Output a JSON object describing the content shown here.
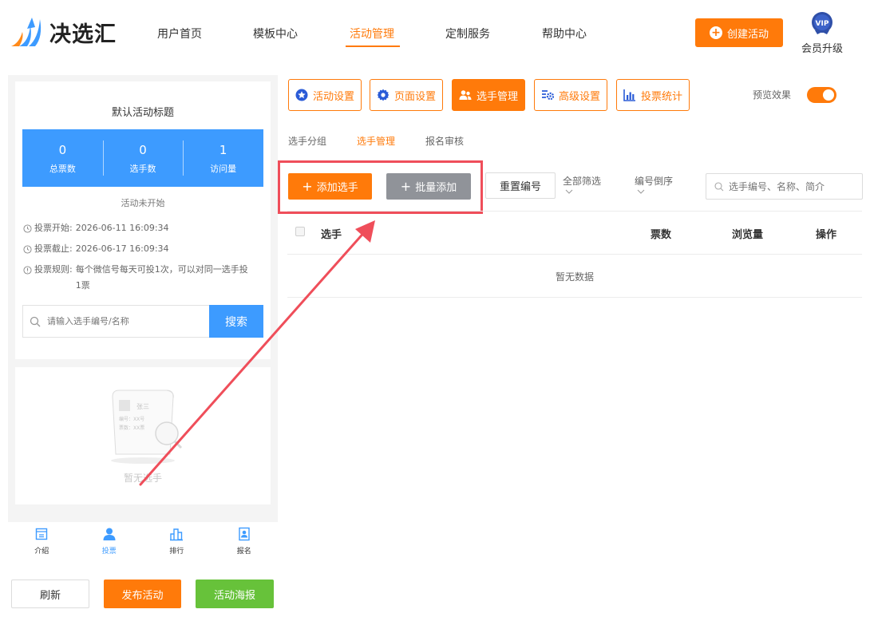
{
  "brand": {
    "name": "决选汇"
  },
  "nav": [
    {
      "label": "用户首页",
      "active": false
    },
    {
      "label": "模板中心",
      "active": false
    },
    {
      "label": "活动管理",
      "active": true
    },
    {
      "label": "定制服务",
      "active": false
    },
    {
      "label": "帮助中心",
      "active": false
    }
  ],
  "header": {
    "create_label": "创建活动",
    "vip_badge": "VIP",
    "vip_label": "会员升级"
  },
  "preview": {
    "title": "默认活动标题",
    "stats": [
      {
        "value": "0",
        "label": "总票数"
      },
      {
        "value": "0",
        "label": "选手数"
      },
      {
        "value": "1",
        "label": "访问量"
      }
    ],
    "status": "活动未开始",
    "info": [
      {
        "label": "投票开始:",
        "value": "2026-06-11 16:09:34"
      },
      {
        "label": "投票截止:",
        "value": "2026-06-17 16:09:34"
      },
      {
        "label": "投票规则:",
        "value": "每个微信号每天可投1次，可以对同一选手投1票"
      }
    ],
    "search_placeholder": "请输入选手编号/名称",
    "search_label": "搜索",
    "empty_card": {
      "name": "张三",
      "number": "编号：XX号",
      "votes": "票数：XX票"
    },
    "empty_text": "暂无选手",
    "tabs": [
      {
        "label": "介绍",
        "icon": "intro-icon",
        "active": false
      },
      {
        "label": "投票",
        "icon": "user-icon",
        "active": true
      },
      {
        "label": "排行",
        "icon": "ranking-icon",
        "active": false
      },
      {
        "label": "报名",
        "icon": "signup-icon",
        "active": false
      }
    ]
  },
  "bottom": {
    "refresh": "刷新",
    "publish": "发布活动",
    "poster": "活动海报"
  },
  "toolbar": [
    {
      "label": "活动设置",
      "icon": "star-icon",
      "active": false
    },
    {
      "label": "页面设置",
      "icon": "gear-icon",
      "active": false
    },
    {
      "label": "选手管理",
      "icon": "users-icon",
      "active": true
    },
    {
      "label": "高级设置",
      "icon": "settings-icon",
      "active": false
    },
    {
      "label": "投票统计",
      "icon": "bar-chart-icon",
      "active": false
    }
  ],
  "preview_toggle": {
    "label": "预览效果",
    "on": true
  },
  "subtabs": [
    {
      "label": "选手分组",
      "active": false
    },
    {
      "label": "选手管理",
      "active": true
    },
    {
      "label": "报名审核",
      "active": false
    }
  ],
  "actions": {
    "add": "添加选手",
    "batch": "批量添加",
    "reset": "重置编号",
    "filter": "全部筛选",
    "sort": "编号倒序",
    "search_placeholder": "选手编号、名称、简介"
  },
  "table": {
    "columns": [
      "选手",
      "票数",
      "浏览量",
      "操作"
    ],
    "empty": "暂无数据"
  },
  "colors": {
    "accent": "#ff7a0a",
    "blue": "#3d9bff",
    "green": "#67c23a",
    "gray": "#909399",
    "annotation": "#ef4e5a"
  }
}
